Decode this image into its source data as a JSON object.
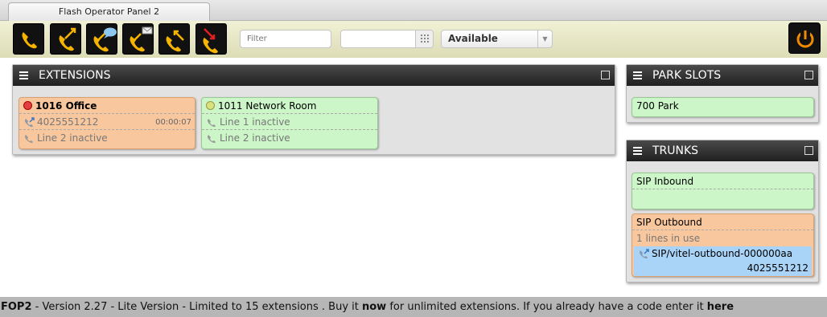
{
  "window": {
    "tab_title": "Flash Operator Panel 2"
  },
  "toolbar": {
    "buttons": [
      {
        "name": "dial",
        "icon": "phone-handset-icon"
      },
      {
        "name": "transfer",
        "icon": "phone-transfer-icon"
      },
      {
        "name": "chat",
        "icon": "phone-chat-icon"
      },
      {
        "name": "voicemail",
        "icon": "phone-voicemail-icon"
      },
      {
        "name": "pickup",
        "icon": "phone-pickup-icon"
      },
      {
        "name": "hangup",
        "icon": "phone-hangup-icon"
      }
    ],
    "filter_placeholder": "Filter",
    "status_value": "Available",
    "logout_icon": "power-icon"
  },
  "extensions": {
    "title": "EXTENSIONS",
    "cards": [
      {
        "name": "1016 Office",
        "state": "busy",
        "rows": [
          {
            "text": "4025551212",
            "timer": "00:00:07"
          },
          {
            "text": "Line 2 inactive"
          }
        ]
      },
      {
        "name": "1011 Network Room",
        "state": "idle",
        "rows": [
          {
            "text": "Line 1 inactive"
          },
          {
            "text": "Line 2 inactive"
          }
        ]
      }
    ]
  },
  "parkslots": {
    "title": "PARK SLOTS",
    "items": [
      "700 Park"
    ]
  },
  "trunks": {
    "title": "TRUNKS",
    "items": [
      {
        "name": "SIP Inbound"
      },
      {
        "name": "SIP Outbound",
        "status": "1 lines in use",
        "channel": "SIP/vitel-outbound-000000aa",
        "number": "4025551212"
      }
    ]
  },
  "footer": {
    "brand": "FOP2",
    "text1": " - Version 2.27 - Lite Version - Limited to 15 extensions . Buy it ",
    "now": "now",
    "text2": " for unlimited extensions. If you already have a code enter it ",
    "here": "here"
  },
  "colors": {
    "idle": "#ccf5c8",
    "busy": "#f9c79d",
    "selected": "#a9d4f7",
    "icon": "#f5b400",
    "header": "#2b2b2b"
  }
}
